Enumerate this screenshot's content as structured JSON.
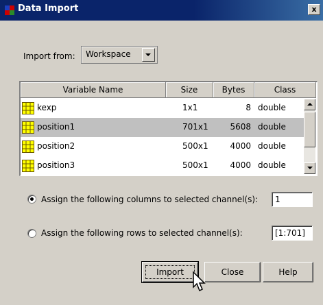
{
  "window": {
    "title": "Data Import",
    "close_label": "x"
  },
  "import_from": {
    "label": "Import from:",
    "value": "Workspace"
  },
  "table": {
    "headers": [
      "Variable Name",
      "Size",
      "Bytes",
      "Class"
    ],
    "rows": [
      {
        "name": "kexp",
        "size": "1x1",
        "bytes": "8",
        "class": "double",
        "selected": false
      },
      {
        "name": "position1",
        "size": "701x1",
        "bytes": "5608",
        "class": "double",
        "selected": true
      },
      {
        "name": "position2",
        "size": "500x1",
        "bytes": "4000",
        "class": "double",
        "selected": false
      },
      {
        "name": "position3",
        "size": "500x1",
        "bytes": "4000",
        "class": "double",
        "selected": false
      }
    ]
  },
  "options": {
    "columns": {
      "label": "Assign the following columns to selected channel(s):",
      "value": "1",
      "checked": true
    },
    "rows": {
      "label": "Assign the following rows to selected channel(s):",
      "value": "[1:701]",
      "checked": false
    }
  },
  "buttons": {
    "import": "Import",
    "close": "Close",
    "help": "Help"
  },
  "colors": {
    "titlebar": "#0a246a",
    "dialog": "#d4d0c8",
    "selected_row": "#c0c0c0",
    "icon_yellow": "#ffff00"
  }
}
